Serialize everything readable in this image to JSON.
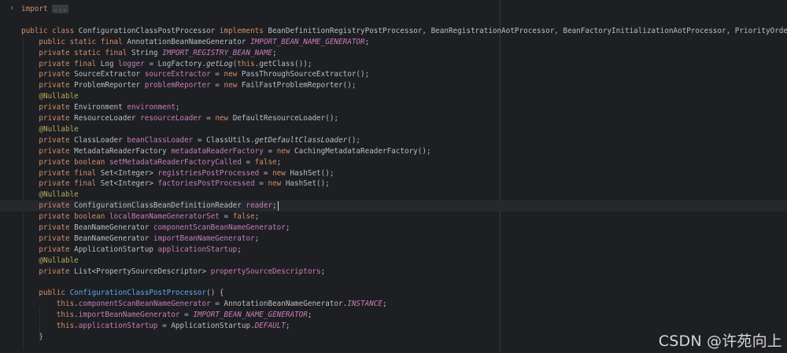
{
  "editor": {
    "current_line_index": 18,
    "colors": {
      "background": "#1e1f22",
      "default": "#bcbec4",
      "keyword": "#cf8e6d",
      "field": "#c77dbb",
      "annotation": "#b3ae60",
      "method": "#56a8f5",
      "folded": "#7a7e85",
      "current_line": "#26282e"
    },
    "fold_icon": "chevron-right-icon",
    "lines": [
      [
        [
          "k",
          "import"
        ],
        [
          "t",
          " "
        ],
        [
          "fold",
          "..."
        ]
      ],
      [],
      [
        [
          "k",
          "public class "
        ],
        [
          "t",
          "ConfigurationClassPostProcessor "
        ],
        [
          "k",
          "implements "
        ],
        [
          "t",
          "BeanDefinitionRegistryPostProcessor, BeanRegistrationAotProcessor, BeanFactoryInitializationAotProcessor, PriorityOrdered, ResourceLoade"
        ]
      ],
      [
        [
          "t",
          "    "
        ],
        [
          "k",
          "public static final "
        ],
        [
          "t",
          "AnnotationBeanNameGenerator "
        ],
        [
          "s",
          "IMPORT_BEAN_NAME_GENERATOR"
        ],
        [
          "t",
          ";"
        ]
      ],
      [
        [
          "t",
          "    "
        ],
        [
          "k",
          "private static final "
        ],
        [
          "t",
          "String "
        ],
        [
          "s",
          "IMPORT_REGISTRY_BEAN_NAME"
        ],
        [
          "t",
          ";"
        ]
      ],
      [
        [
          "t",
          "    "
        ],
        [
          "k",
          "private final "
        ],
        [
          "t",
          "Log "
        ],
        [
          "f",
          "logger"
        ],
        [
          "t",
          " = LogFactory."
        ],
        [
          "i",
          "getLog"
        ],
        [
          "t",
          "("
        ],
        [
          "k",
          "this"
        ],
        [
          "t",
          ".getClass());"
        ]
      ],
      [
        [
          "t",
          "    "
        ],
        [
          "k",
          "private "
        ],
        [
          "t",
          "SourceExtractor "
        ],
        [
          "f",
          "sourceExtractor"
        ],
        [
          "t",
          " = "
        ],
        [
          "k",
          "new "
        ],
        [
          "t",
          "PassThroughSourceExtractor();"
        ]
      ],
      [
        [
          "t",
          "    "
        ],
        [
          "k",
          "private "
        ],
        [
          "t",
          "ProblemReporter "
        ],
        [
          "f",
          "problemReporter"
        ],
        [
          "t",
          " = "
        ],
        [
          "k",
          "new "
        ],
        [
          "t",
          "FailFastProblemReporter();"
        ]
      ],
      [
        [
          "t",
          "    "
        ],
        [
          "a",
          "@Nullable"
        ]
      ],
      [
        [
          "t",
          "    "
        ],
        [
          "k",
          "private "
        ],
        [
          "t",
          "Environment "
        ],
        [
          "f",
          "environment"
        ],
        [
          "t",
          ";"
        ]
      ],
      [
        [
          "t",
          "    "
        ],
        [
          "k",
          "private "
        ],
        [
          "t",
          "ResourceLoader "
        ],
        [
          "f",
          "resourceLoader"
        ],
        [
          "t",
          " = "
        ],
        [
          "k",
          "new "
        ],
        [
          "t",
          "DefaultResourceLoader();"
        ]
      ],
      [
        [
          "t",
          "    "
        ],
        [
          "a",
          "@Nullable"
        ]
      ],
      [
        [
          "t",
          "    "
        ],
        [
          "k",
          "private "
        ],
        [
          "t",
          "ClassLoader "
        ],
        [
          "f",
          "beanClassLoader"
        ],
        [
          "t",
          " = ClassUtils."
        ],
        [
          "i",
          "getDefaultClassLoader"
        ],
        [
          "t",
          "();"
        ]
      ],
      [
        [
          "t",
          "    "
        ],
        [
          "k",
          "private "
        ],
        [
          "t",
          "MetadataReaderFactory "
        ],
        [
          "f",
          "metadataReaderFactory"
        ],
        [
          "t",
          " = "
        ],
        [
          "k",
          "new "
        ],
        [
          "t",
          "CachingMetadataReaderFactory();"
        ]
      ],
      [
        [
          "t",
          "    "
        ],
        [
          "k",
          "private boolean "
        ],
        [
          "f",
          "setMetadataReaderFactoryCalled"
        ],
        [
          "t",
          " = "
        ],
        [
          "k",
          "false"
        ],
        [
          "t",
          ";"
        ]
      ],
      [
        [
          "t",
          "    "
        ],
        [
          "k",
          "private final "
        ],
        [
          "t",
          "Set<Integer> "
        ],
        [
          "f",
          "registriesPostProcessed"
        ],
        [
          "t",
          " = "
        ],
        [
          "k",
          "new "
        ],
        [
          "t",
          "HashSet();"
        ]
      ],
      [
        [
          "t",
          "    "
        ],
        [
          "k",
          "private final "
        ],
        [
          "t",
          "Set<Integer> "
        ],
        [
          "f",
          "factoriesPostProcessed"
        ],
        [
          "t",
          " = "
        ],
        [
          "k",
          "new "
        ],
        [
          "t",
          "HashSet();"
        ]
      ],
      [
        [
          "t",
          "    "
        ],
        [
          "a",
          "@Nullable"
        ]
      ],
      [
        [
          "t",
          "    "
        ],
        [
          "k",
          "private "
        ],
        [
          "t",
          "ConfigurationClassBeanDefinitionReader "
        ],
        [
          "f",
          "reader"
        ],
        [
          "t",
          ";"
        ]
      ],
      [
        [
          "t",
          "    "
        ],
        [
          "k",
          "private boolean "
        ],
        [
          "f",
          "localBeanNameGeneratorSet"
        ],
        [
          "t",
          " = "
        ],
        [
          "k",
          "false"
        ],
        [
          "t",
          ";"
        ]
      ],
      [
        [
          "t",
          "    "
        ],
        [
          "k",
          "private "
        ],
        [
          "t",
          "BeanNameGenerator "
        ],
        [
          "f",
          "componentScanBeanNameGenerator"
        ],
        [
          "t",
          ";"
        ]
      ],
      [
        [
          "t",
          "    "
        ],
        [
          "k",
          "private "
        ],
        [
          "t",
          "BeanNameGenerator "
        ],
        [
          "f",
          "importBeanNameGenerator"
        ],
        [
          "t",
          ";"
        ]
      ],
      [
        [
          "t",
          "    "
        ],
        [
          "k",
          "private "
        ],
        [
          "t",
          "ApplicationStartup "
        ],
        [
          "f",
          "applicationStartup"
        ],
        [
          "t",
          ";"
        ]
      ],
      [
        [
          "t",
          "    "
        ],
        [
          "a",
          "@Nullable"
        ]
      ],
      [
        [
          "t",
          "    "
        ],
        [
          "k",
          "private "
        ],
        [
          "t",
          "List<PropertySourceDescriptor> "
        ],
        [
          "f",
          "propertySourceDescriptors"
        ],
        [
          "t",
          ";"
        ]
      ],
      [],
      [
        [
          "t",
          "    "
        ],
        [
          "k",
          "public "
        ],
        [
          "m",
          "ConfigurationClassPostProcessor"
        ],
        [
          "t",
          "() {"
        ]
      ],
      [
        [
          "t",
          "        "
        ],
        [
          "k",
          "this"
        ],
        [
          "t",
          "."
        ],
        [
          "f",
          "componentScanBeanNameGenerator"
        ],
        [
          "t",
          " = AnnotationBeanNameGenerator."
        ],
        [
          "s",
          "INSTANCE"
        ],
        [
          "t",
          ";"
        ]
      ],
      [
        [
          "t",
          "        "
        ],
        [
          "k",
          "this"
        ],
        [
          "t",
          "."
        ],
        [
          "f",
          "importBeanNameGenerator"
        ],
        [
          "t",
          " = "
        ],
        [
          "s",
          "IMPORT_BEAN_NAME_GENERATOR"
        ],
        [
          "t",
          ";"
        ]
      ],
      [
        [
          "t",
          "        "
        ],
        [
          "k",
          "this"
        ],
        [
          "t",
          "."
        ],
        [
          "f",
          "applicationStartup"
        ],
        [
          "t",
          " = ApplicationStartup."
        ],
        [
          "s",
          "DEFAULT"
        ],
        [
          "t",
          ";"
        ]
      ],
      [
        [
          "t",
          "    }"
        ]
      ]
    ]
  },
  "watermark": {
    "text": "CSDN @许苑向上"
  }
}
